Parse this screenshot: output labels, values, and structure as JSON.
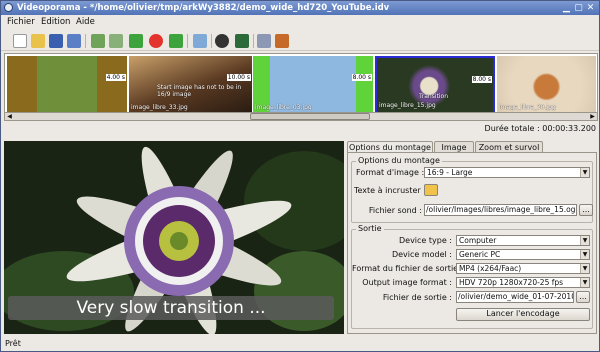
{
  "window": {
    "title": "Videoporama - */home/olivier/tmp/arkWy3882/demo_wide_hd720_YouTube.idv"
  },
  "menubar": {
    "items": [
      "Fichier",
      "Edition",
      "Aide"
    ]
  },
  "toolbar": {
    "icons": [
      "new-icon",
      "open-icon",
      "save-icon",
      "save-as-icon",
      "add-image-icon",
      "add-text-icon",
      "move-left-icon",
      "delete-icon",
      "move-right-icon",
      "refresh-icon",
      "preview-icon",
      "film-icon",
      "settings-icon",
      "render-icon"
    ]
  },
  "thumbnails": [
    {
      "caption": "",
      "duration": "4.00 s",
      "color": "#8a6a1c"
    },
    {
      "caption": "image_libre_33.jpg",
      "duration": "10.00 s",
      "color": "#6b4a2e",
      "overlay": "Start image has not to be in 16/9 image"
    },
    {
      "caption": "image_libre_03.jpg",
      "duration": "8.00 s",
      "color": "#3d8a2e"
    },
    {
      "caption": "image_libre_15.jpg",
      "duration": "8.00 s",
      "color": "#2a3522",
      "overlay": "Transition"
    },
    {
      "caption": "image_libre_30.jpg",
      "duration": "",
      "color": "#8c4a28"
    }
  ],
  "timeline": {
    "total_label": "Durée totale : 00:00:33.200"
  },
  "preview": {
    "subtitle": "Very slow transition ..."
  },
  "tabs": [
    "Options du montage",
    "Image",
    "Zoom et survol"
  ],
  "options": {
    "group_title": "Options du montage",
    "format_label": "Format d'image :",
    "format_value": "16:9 - Large",
    "text_label": "Texte à incruster :",
    "sound_label": "Fichier sond :",
    "sound_value": "/olivier/Images/libres/image_libre_15.ogg",
    "browse": "..."
  },
  "sortie": {
    "group_title": "Sortie",
    "device_type_label": "Device type :",
    "device_type_value": "Computer",
    "device_model_label": "Device model :",
    "device_model_value": "Generic PC",
    "out_format_label": "Format du fichier de sortie :",
    "out_format_value": "MP4 (x264/Faac)",
    "out_image_label": "Output image format :",
    "out_image_value": "HDV 720p 1280x720-25 fps",
    "out_file_label": "Fichier de sortie :",
    "out_file_value": "/olivier/demo_wide_01-07-2010",
    "browse": "...",
    "encode_button": "Lancer l'encodage"
  },
  "status": {
    "text": "Prêt"
  }
}
